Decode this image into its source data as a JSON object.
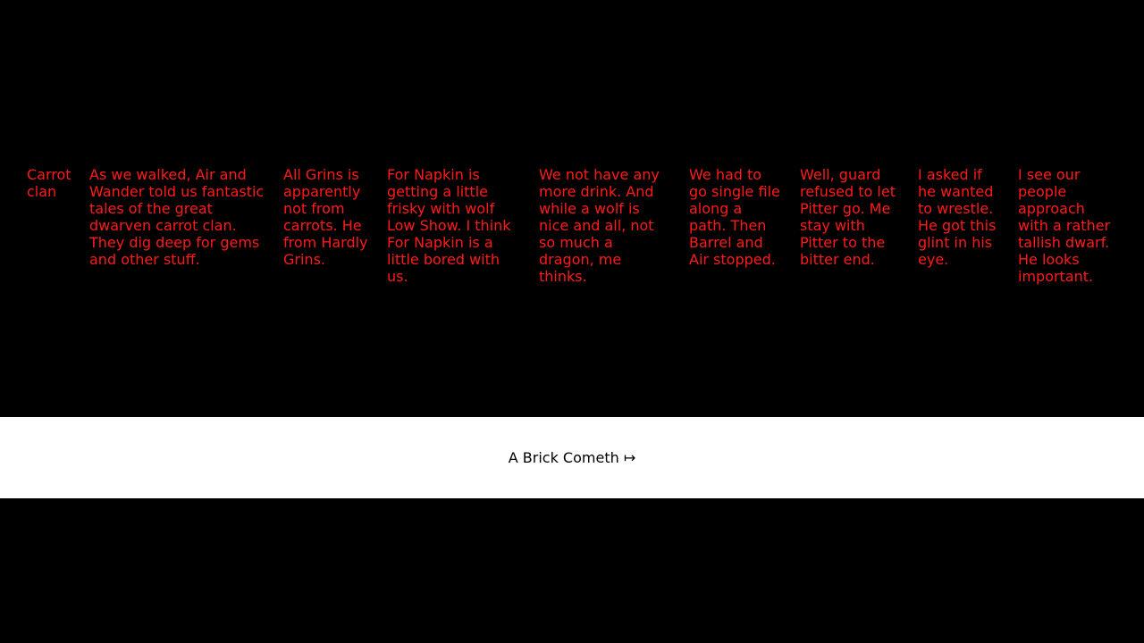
{
  "colors": {
    "background": "#000000",
    "story_text": "#ff1a1a",
    "nav_background": "#ffffff",
    "nav_text": "#000000"
  },
  "story": {
    "columns": [
      "Carrot clan",
      "As we walked, Air and Wander told us fantastic tales of the great dwarven carrot clan. They dig deep for gems and other stuff.",
      "All Grins is apparently not from carrots. He from Hardly Grins.",
      "For Napkin is getting a little frisky with wolf Low Show. I think For Napkin is a little bored with us.",
      "We not have any more drink. And while a wolf is nice and all, not so much a dragon, me thinks.",
      "We had to go single file along a path. Then Barrel and Air stopped.",
      "Well, guard refused to let Pitter go. Me stay with Pitter to the bitter end.",
      "I asked if he wanted to wrestle. He got this glint in his eye.",
      "I see our people approach with a rather tallish dwarf. He looks important."
    ]
  },
  "nav": {
    "next_label": "A Brick Cometh ↦"
  }
}
